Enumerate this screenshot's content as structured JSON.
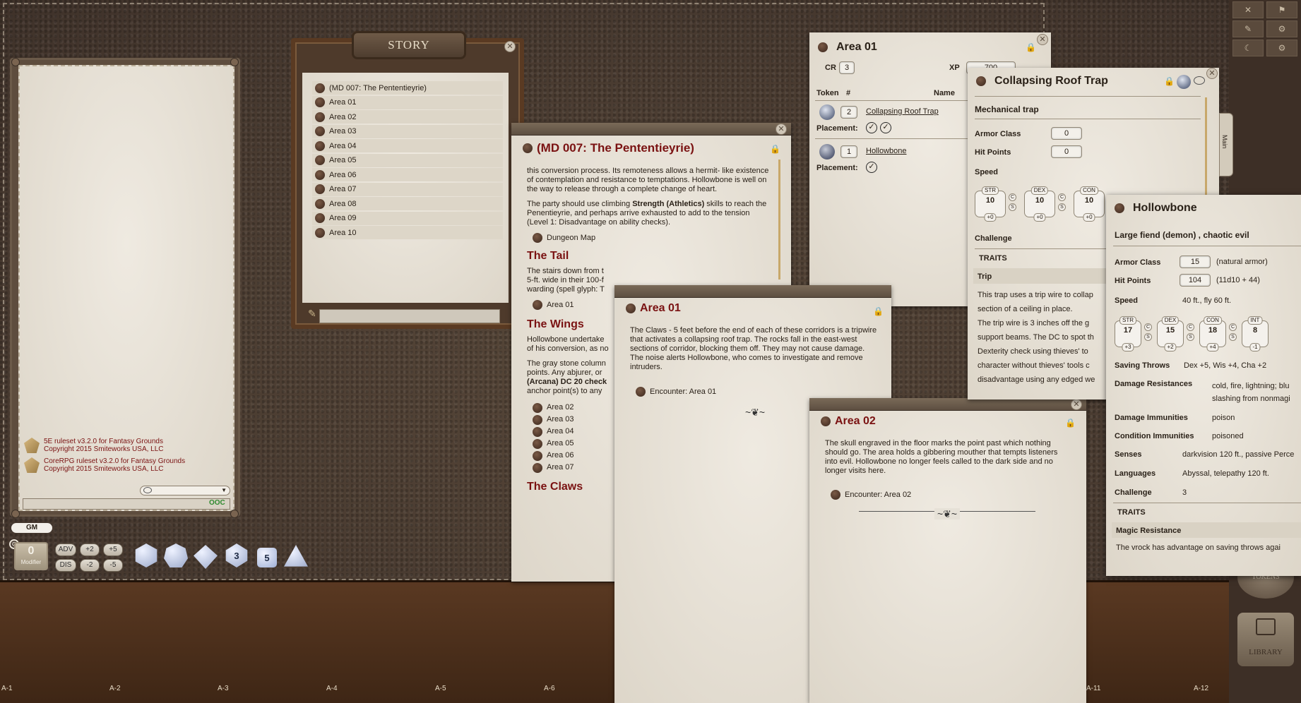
{
  "chat": {
    "messages": [
      {
        "line1": "5E ruleset v3.2.0 for Fantasy Grounds",
        "line2": "Copyright 2015 Smiteworks USA, LLC"
      },
      {
        "line1": "CoreRPG ruleset v3.2.0 for Fantasy Grounds",
        "line2": "Copyright 2015 Smiteworks USA, LLC"
      }
    ],
    "ooc_label": "OOC",
    "gm_label": "GM"
  },
  "modifier": {
    "value": "0",
    "label": "Modifier"
  },
  "mod_buttons": {
    "adv": "ADV",
    "dis": "DIS",
    "p2": "+2",
    "p5": "+5",
    "m2": "-2",
    "m5": "-5"
  },
  "dice": [
    "d20",
    "d12",
    "d10",
    "d8",
    "d6",
    "d4"
  ],
  "dice_faces": {
    "d6": "5",
    "d8": "3"
  },
  "grid_labels": [
    "A-1",
    "A-2",
    "A-3",
    "A-4",
    "A-5",
    "A-6",
    "A-11",
    "A-12"
  ],
  "story": {
    "title": "STORY",
    "items": [
      "(MD 007: The Pententieyrie)",
      "Area 01",
      "Area 02",
      "Area 03",
      "Area 04",
      "Area 05",
      "Area 06",
      "Area 07",
      "Area 08",
      "Area 09",
      "Area 10"
    ]
  },
  "md007": {
    "title": "(MD 007: The Pententieyrie)",
    "p1": "this conversion process. Its remoteness allows a hermit- like existence of contemplation and resistance to temptations. Hollowbone is well on the way to release through a complete change of heart.",
    "p2a": "The party should use climbing ",
    "p2b": "Strength (Athletics)",
    "p2c": " skills to reach the Penentieyrie, and perhaps arrive exhausted to add to the tension (Level 1: Disadvantage on ability checks).",
    "link_map": "Dungeon Map",
    "h_tail": "The Tail",
    "tail_text": "The stairs down from t\n5-ft. wide in their 100-f\nwarding (spell glyph: T",
    "link_area01": "Area 01",
    "h_wings": "The Wings",
    "wings1": "Hollowbone undertake\nof his conversion, as no",
    "wings2a": "The gray stone column\npoints. Any abjurer, or\n",
    "wings2b": "(Arcana) DC 20 check",
    "wings2c": "\nanchor point(s) to any",
    "links": [
      "Area 02",
      "Area 03",
      "Area 04",
      "Area 05",
      "Area 06",
      "Area 07"
    ],
    "h_claws": "The Claws"
  },
  "encounter": {
    "title": "Area 01",
    "cr_label": "CR",
    "cr": "3",
    "xp_label": "XP",
    "xp": "700",
    "col_token": "Token",
    "col_num": "#",
    "col_name": "Name",
    "rows": [
      {
        "count": "2",
        "name": "Collapsing Roof Trap",
        "placement": "Placement:"
      },
      {
        "count": "1",
        "name": "Hollowbone",
        "placement": "Placement:"
      }
    ]
  },
  "area01": {
    "title": "Area 01",
    "text": "The Claws - 5 feet before the end of each of these corridors is a tripwire that activates a collapsing roof trap. The rocks fall in the east-west sections of corridor, blocking them off. They may not cause damage. The noise alerts Hollowbone, who comes to investigate and remove intruders.",
    "link": "Encounter: Area 01"
  },
  "area02": {
    "title": "Area 02",
    "text": "The skull engraved in the floor marks the point past which nothing should go. The area holds a gibbering mouther that tempts listeners into evil. Hollowbone no longer feels called to the dark side and no longer visits here.",
    "link": "Encounter: Area 02"
  },
  "trap": {
    "title": "Collapsing Roof Trap",
    "type": "Mechanical trap",
    "ac_label": "Armor Class",
    "ac": "0",
    "hp_label": "Hit Points",
    "hp": "0",
    "speed_label": "Speed",
    "stats": [
      {
        "name": "STR",
        "val": "10",
        "mod": "+0"
      },
      {
        "name": "DEX",
        "val": "10",
        "mod": "+0"
      },
      {
        "name": "CON",
        "val": "10",
        "mod": "+0"
      }
    ],
    "challenge_label": "Challenge",
    "traits_label": "TRAITS",
    "trait_name": "Trip",
    "trait_text": "This trap uses a trip wire to collap\nsection of a ceiling in place.\nThe trip wire is 3 inches off the g\nsupport beams. The DC to spot th\nDexterity check using thieves' to\ncharacter without thieves' tools c\ndisadvantage using any edged we",
    "side_tab": "Main"
  },
  "hollowbone": {
    "title": "Hollowbone",
    "type": "Large fiend (demon) , chaotic evil",
    "ac_label": "Armor Class",
    "ac": "15",
    "ac_note": "(natural armor)",
    "hp_label": "Hit Points",
    "hp": "104",
    "hp_note": "(11d10 + 44)",
    "speed_label": "Speed",
    "speed": "40 ft., fly 60 ft.",
    "stats": [
      {
        "name": "STR",
        "val": "17",
        "mod": "+3"
      },
      {
        "name": "DEX",
        "val": "15",
        "mod": "+2"
      },
      {
        "name": "CON",
        "val": "18",
        "mod": "+4"
      },
      {
        "name": "INT",
        "val": "8",
        "mod": "-1"
      }
    ],
    "saves_label": "Saving Throws",
    "saves": "Dex +5, Wis +4, Cha +2",
    "dr_label": "Damage Resistances",
    "dr": "cold, fire, lightning; blu\nslashing from nonmagi",
    "di_label": "Damage Immunities",
    "di": "poison",
    "ci_label": "Condition Immunities",
    "ci": "poisoned",
    "senses_label": "Senses",
    "senses": "darkvision 120 ft., passive Perce",
    "lang_label": "Languages",
    "lang": "Abyssal, telepathy 120 ft.",
    "chal_label": "Challenge",
    "chal": "3",
    "traits_label": "TRAITS",
    "trait_name": "Magic Resistance",
    "trait_text": "The vrock has advantage on saving throws agai"
  },
  "right_dock": {
    "library": "LIBRARY",
    "tokens": "TOKENS"
  },
  "colors": {
    "heading_red": "#7a1212",
    "parchment": "#e9e4da",
    "leather": "#4a3c33"
  }
}
